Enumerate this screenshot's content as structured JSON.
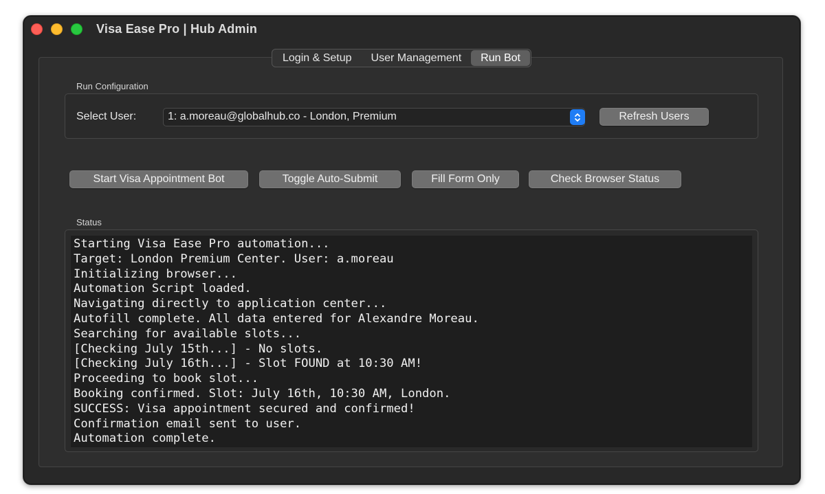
{
  "window": {
    "title": "Visa Ease Pro | Hub Admin"
  },
  "tabs": [
    {
      "label": "Login & Setup",
      "active": false
    },
    {
      "label": "User Management",
      "active": false
    },
    {
      "label": "Run Bot",
      "active": true
    }
  ],
  "run_config": {
    "section_label": "Run Configuration",
    "select_user_label": "Select User:",
    "selected_user": "1: a.moreau@globalhub.co - London, Premium",
    "refresh_button": "Refresh Users"
  },
  "actions": {
    "start_bot": "Start Visa Appointment Bot",
    "toggle_auto_submit": "Toggle Auto-Submit",
    "fill_form_only": "Fill Form Only",
    "check_browser_status": "Check Browser Status"
  },
  "status": {
    "section_label": "Status",
    "lines": [
      "Starting Visa Ease Pro automation...",
      "Target: London Premium Center. User: a.moreau",
      "Initializing browser...",
      "Automation Script loaded.",
      "Navigating directly to application center...",
      "Autofill complete. All data entered for Alexandre Moreau.",
      "Searching for available slots...",
      "[Checking July 15th...] - No slots.",
      "[Checking July 16th...] - Slot FOUND at 10:30 AM!",
      "Proceeding to book slot...",
      "Booking confirmed. Slot: July 16th, 10:30 AM, London.",
      "SUCCESS: Visa appointment secured and confirmed!",
      "Confirmation email sent to user.",
      "Automation complete."
    ]
  },
  "icons": {
    "close": "close-window-icon",
    "minimize": "minimize-window-icon",
    "zoom": "zoom-window-icon",
    "dropdown": "chevron-updown-icon"
  },
  "colors": {
    "close": "#fe5f57",
    "minimize": "#febc2e",
    "zoom": "#28c840",
    "combo_accent": "#1f7df5",
    "active_tab": "#5f5f5f"
  }
}
